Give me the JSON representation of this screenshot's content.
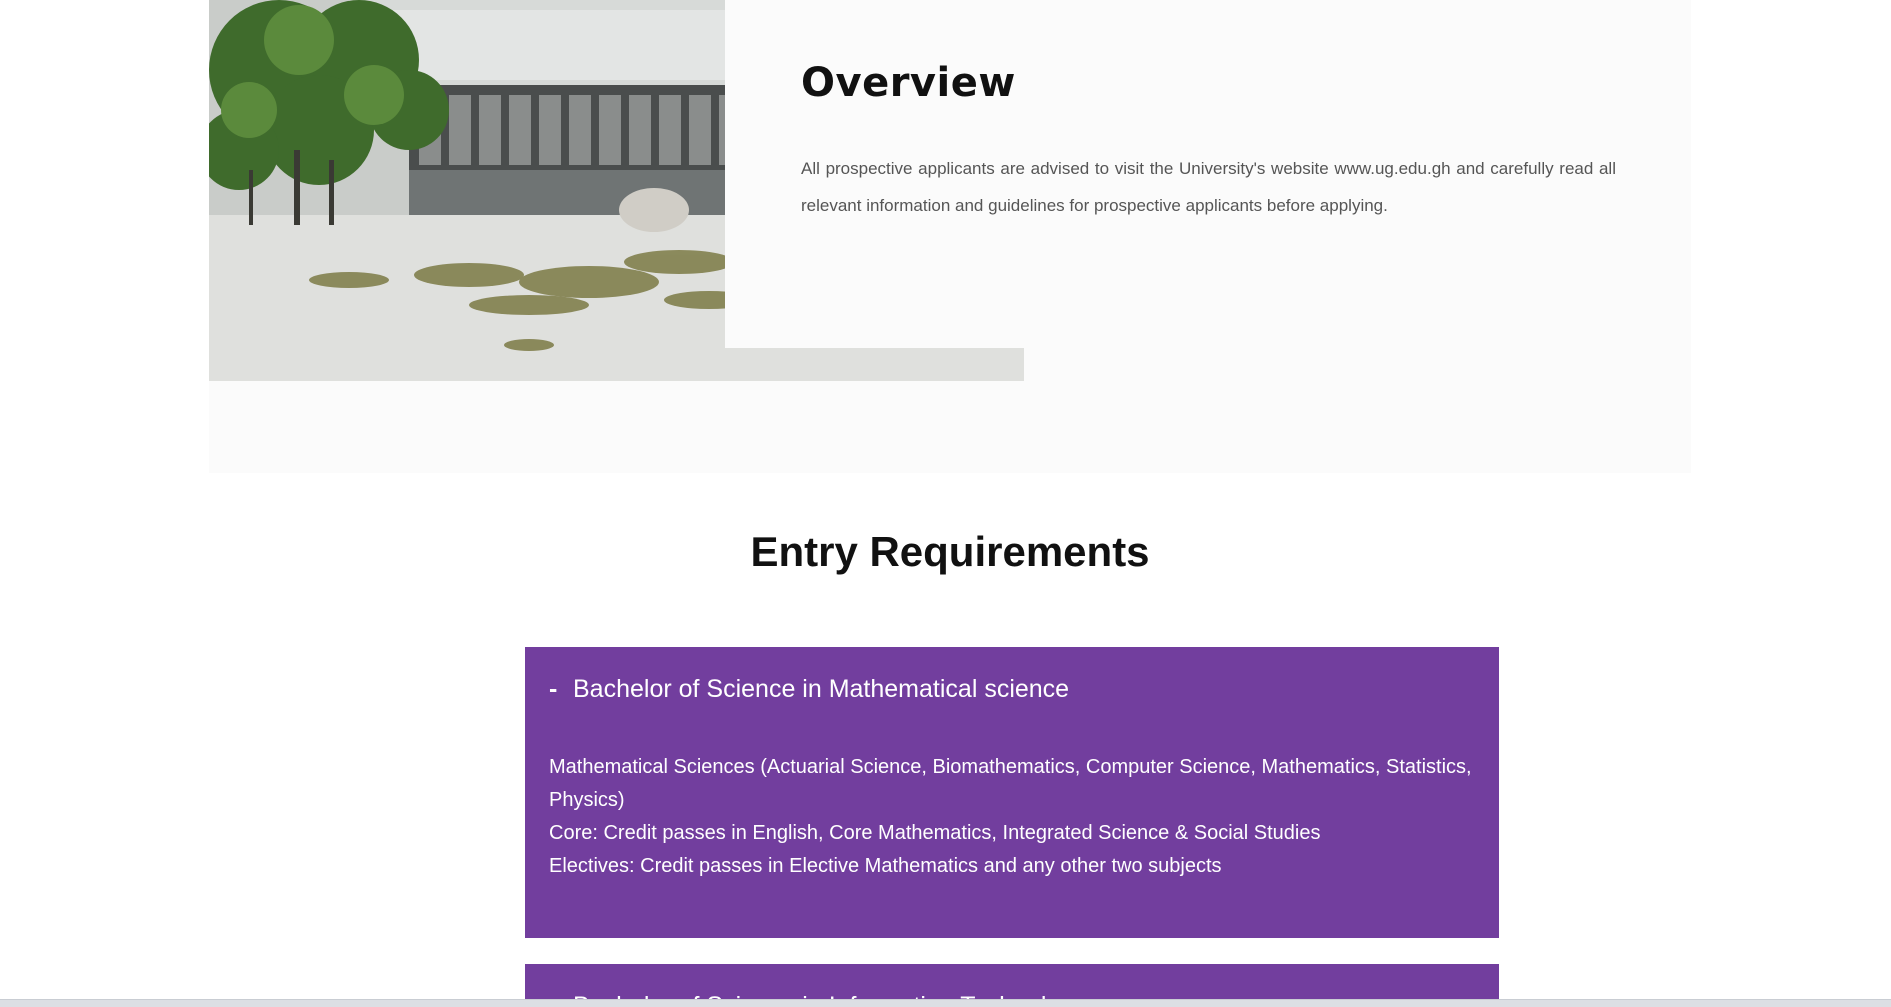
{
  "overview": {
    "title": "Overview",
    "text": "All prospective applicants are advised to visit the University's website www.ug.edu.gh and carefully read all relevant information and guidelines for prospective applicants before applying."
  },
  "entry_requirements": {
    "title": "Entry Requirements",
    "programmes": [
      {
        "toggle": "-",
        "title": "Bachelor of Science in Mathematical science",
        "lines": [
          "Mathematical Sciences (Actuarial Science, Biomathematics, Computer Science, Mathematics, Statistics, Physics)",
          "Core: Credit passes in English, Core Mathematics, Integrated Science & Social Studies",
          "Electives: Credit passes in Elective Mathematics and any other two subjects"
        ]
      },
      {
        "toggle": "+",
        "title": "Bachelor of Science in Information Technology"
      }
    ]
  },
  "colors": {
    "accordion_bg": "#723e9e",
    "section_bg": "#fbfbfb"
  }
}
